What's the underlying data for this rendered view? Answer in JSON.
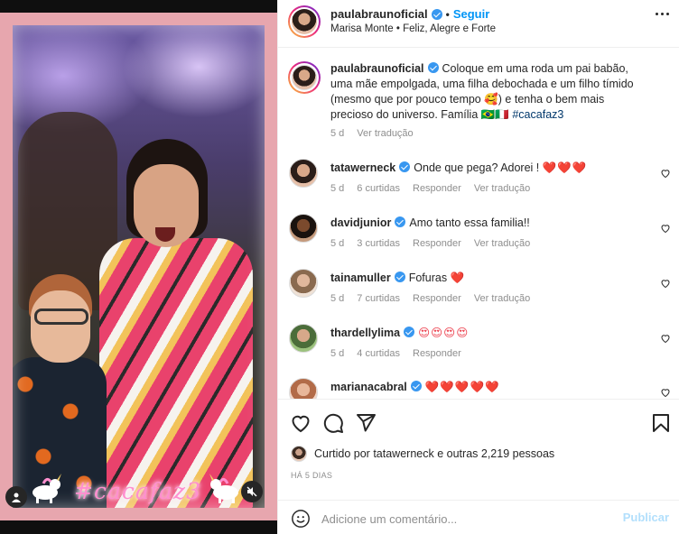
{
  "post": {
    "username": "paulabraunoficial",
    "separator": "•",
    "follow_label": "Seguir",
    "audio_artist": "Marisa Monte",
    "audio_song": "Feliz, Alegre e Forte",
    "audio_separator": "•"
  },
  "media": {
    "hashtag_overlay": "#cacafaz3"
  },
  "caption": {
    "username": "paulabraunoficial",
    "text": "Coloque em uma roda um pai babão, uma mãe empolgada, uma filha debochada e um filho tímido (mesmo que por pouco tempo 🥰) e tenha o bem mais precioso do universo. Família 🇧🇷🇮🇹",
    "hashtag": "#cacafaz3",
    "time": "5 d",
    "translate_label": "Ver tradução"
  },
  "comments": [
    {
      "username": "tatawerneck",
      "verified": true,
      "text": "Onde que pega? Adorei !",
      "hearts": "❤️❤️❤️",
      "time": "5 d",
      "likes": "6 curtidas",
      "reply": "Responder",
      "translate": "Ver tradução"
    },
    {
      "username": "davidjunior",
      "verified": true,
      "text": "Amo tanto essa familia!!",
      "hearts": "",
      "time": "5 d",
      "likes": "3 curtidas",
      "reply": "Responder",
      "translate": "Ver tradução"
    },
    {
      "username": "tainamuller",
      "verified": true,
      "text": "Fofuras",
      "hearts": "❤️",
      "time": "5 d",
      "likes": "7 curtidas",
      "reply": "Responder",
      "translate": "Ver tradução"
    },
    {
      "username": "thardellylima",
      "verified": true,
      "text": "",
      "hearts": "😍😍😍😍",
      "time": "5 d",
      "likes": "4 curtidas",
      "reply": "Responder",
      "translate": ""
    },
    {
      "username": "marianacabral",
      "verified": true,
      "text": "",
      "hearts": "❤️❤️❤️❤️❤️",
      "time": "",
      "likes": "",
      "reply": "",
      "translate": ""
    }
  ],
  "likes": {
    "prefix": "Curtido por",
    "user": "tatawerneck",
    "middle": "e",
    "others": "outras 2,219 pessoas"
  },
  "time_ago": "HÁ 5 DIAS",
  "add_comment": {
    "placeholder": "Adicione um comentário...",
    "post_label": "Publicar"
  },
  "colors": {
    "accent": "#0095f6",
    "heart": "#ed4956",
    "verified": "#3897f0",
    "post_disabled": "#b2dffc",
    "overlay_frame": "#e7a6ae"
  }
}
